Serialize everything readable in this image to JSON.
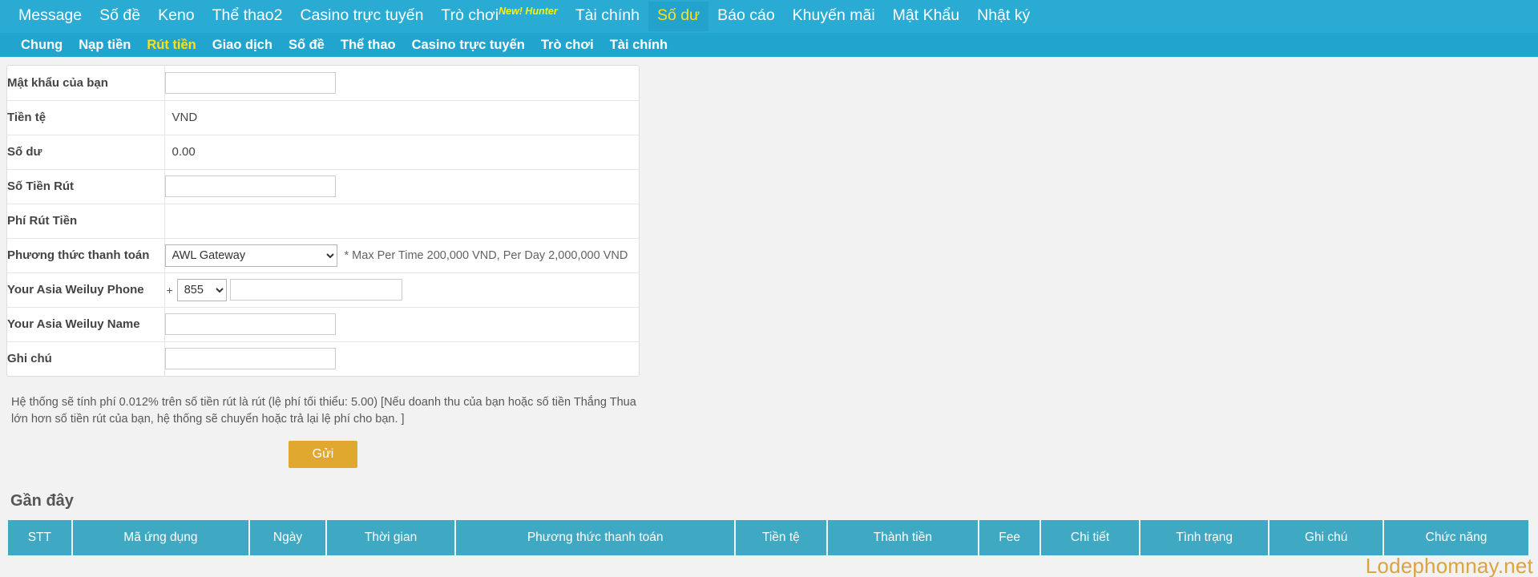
{
  "topnav": {
    "items": [
      {
        "label": "Message",
        "active": false
      },
      {
        "label": "Số đề",
        "active": false
      },
      {
        "label": "Keno",
        "active": false
      },
      {
        "label": "Thể thao2",
        "active": false
      },
      {
        "label": "Casino trực tuyến",
        "active": false
      },
      {
        "label": "Trò chơi",
        "active": false,
        "sup": "New! Hunter"
      },
      {
        "label": "Tài chính",
        "active": false
      },
      {
        "label": "Số dư",
        "active": true
      },
      {
        "label": "Báo cáo",
        "active": false
      },
      {
        "label": "Khuyến mãi",
        "active": false
      },
      {
        "label": "Mật Khẩu",
        "active": false
      },
      {
        "label": "Nhật ký",
        "active": false
      }
    ]
  },
  "subnav": {
    "items": [
      {
        "label": "Chung",
        "active": false
      },
      {
        "label": "Nạp tiền",
        "active": false
      },
      {
        "label": "Rút tiền",
        "active": true
      },
      {
        "label": "Giao dịch",
        "active": false
      },
      {
        "label": "Số đề",
        "active": false
      },
      {
        "label": "Thể thao",
        "active": false
      },
      {
        "label": "Casino trực tuyến",
        "active": false
      },
      {
        "label": "Trò chơi",
        "active": false
      },
      {
        "label": "Tài chính",
        "active": false
      }
    ]
  },
  "form": {
    "password_label": "Mật khẩu của bạn",
    "password_value": "",
    "currency_label": "Tiền tệ",
    "currency_value": "VND",
    "balance_label": "Số dư",
    "balance_value": "0.00",
    "amount_label": "Số Tiền Rút",
    "amount_value": "",
    "fee_label": "Phí Rút Tiền",
    "fee_value": "",
    "payment_label": "Phương thức thanh toán",
    "payment_selected": "AWL Gateway",
    "payment_options": [
      "AWL Gateway"
    ],
    "payment_hint": "* Max Per Time 200,000 VND, Per Day 2,000,000 VND",
    "phone_label": "Your Asia Weiluy Phone",
    "phone_prefix_sign": "+",
    "phone_cc_selected": "855",
    "phone_cc_options": [
      "855"
    ],
    "phone_value": "",
    "name_label": "Your Asia Weiluy Name",
    "name_value": "",
    "note_label": "Ghi chú",
    "note_value": "",
    "footnote": "Hệ thống sẽ tính phí 0.012% trên số tiền rút là rút (lệ phí tối thiểu: 5.00) [Nếu doanh thu của bạn hoặc số tiền Thắng Thua lớn hơn số tiền rút của bạn, hệ thống sẽ chuyển hoặc trả lại lệ phí cho bạn. ]",
    "submit_label": "Gửi"
  },
  "recent": {
    "title": "Gần đây",
    "columns": [
      "STT",
      "Mã ứng dụng",
      "Ngày",
      "Thời gian",
      "Phương thức thanh toán",
      "Tiền tệ",
      "Thành tiền",
      "Fee",
      "Chi tiết",
      "Tình trạng",
      "Ghi chú",
      "Chức năng"
    ],
    "rows": []
  },
  "watermark": "Lodephomnay.net",
  "colors": {
    "topnav_bg": "#29ABD4",
    "subnav_bg": "#21A5CE",
    "active_text": "#FFE11A",
    "submit_bg": "#E0A82E",
    "table_header_bg": "#3FA9C4",
    "watermark": "#D9A441"
  }
}
